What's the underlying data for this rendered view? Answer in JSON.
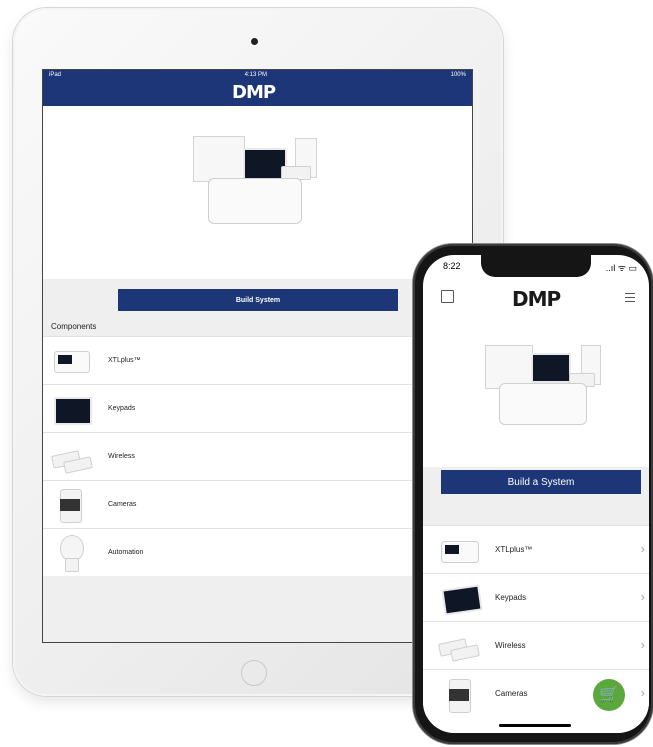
{
  "ipad": {
    "status": {
      "carrier": "iPad",
      "time": "4:13 PM",
      "battery": "100%"
    },
    "logo": "DMP",
    "build_button": "Build System",
    "components_label": "Components",
    "items": [
      {
        "label": "XTLplus™",
        "icon": "panel-icon"
      },
      {
        "label": "Keypads",
        "icon": "keypad-icon"
      },
      {
        "label": "Wireless",
        "icon": "wireless-sensor-icon"
      },
      {
        "label": "Cameras",
        "icon": "camera-icon"
      },
      {
        "label": "Automation",
        "icon": "bulb-icon"
      }
    ]
  },
  "iphone": {
    "status": {
      "time": "8:22",
      "icons": "..ıl ᯤ ▭"
    },
    "logo": "DMP",
    "build_button": "Build a System",
    "items": [
      {
        "label": "XTLplus™"
      },
      {
        "label": "Keypads"
      },
      {
        "label": "Wireless"
      },
      {
        "label": "Cameras"
      }
    ],
    "chevron": "›",
    "cart_icon": "🛒"
  },
  "colors": {
    "brand_blue": "#1c3677",
    "cart_green": "#5aa83b"
  }
}
